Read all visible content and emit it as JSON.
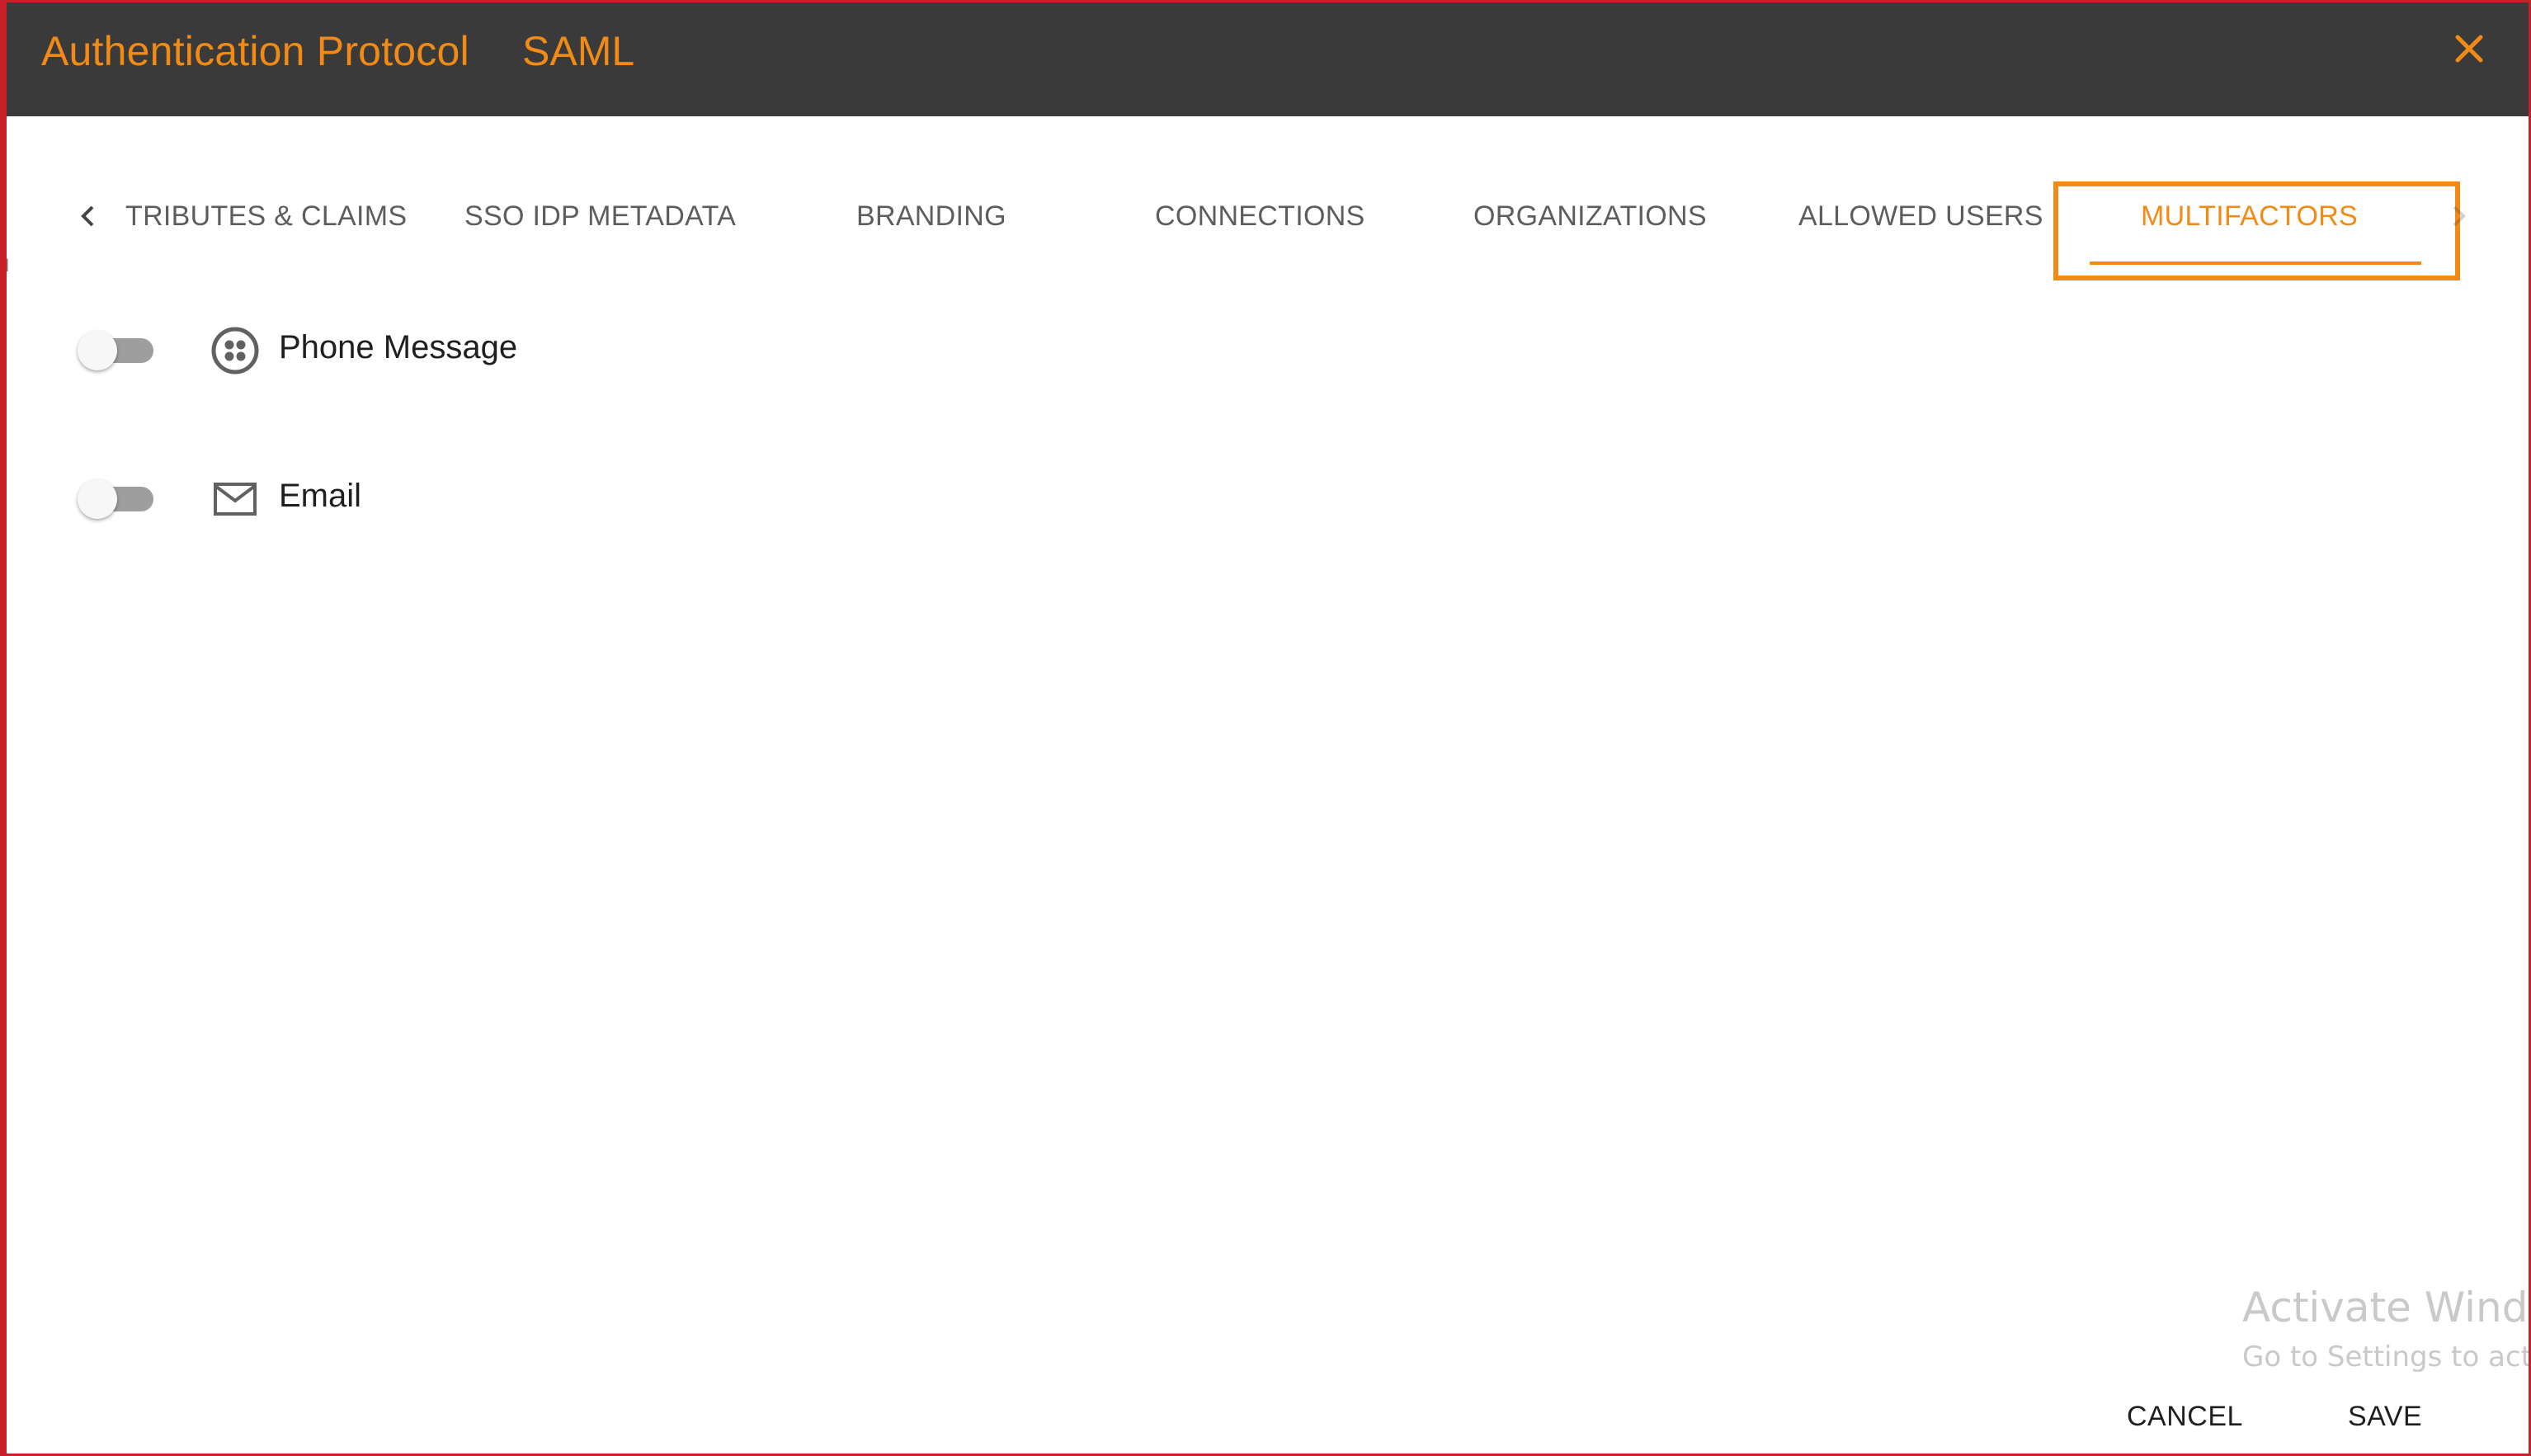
{
  "dialog": {
    "title": "Authentication Protocol",
    "protocol": "SAML"
  },
  "icons": {
    "close": "close-icon",
    "tab_left": "chevron-left-icon",
    "tab_right": "chevron-right-icon",
    "phone": "twilio-icon",
    "email": "mail-icon"
  },
  "colors": {
    "accent": "#f28a16",
    "header_bg": "#3a3a3a",
    "frame_border": "#c8202a"
  },
  "tabs": [
    {
      "label": "TRIBUTES & CLAIMS",
      "active": false
    },
    {
      "label": "SSO IDP METADATA",
      "active": false
    },
    {
      "label": "BRANDING",
      "active": false
    },
    {
      "label": "CONNECTIONS",
      "active": false
    },
    {
      "label": "ORGANIZATIONS",
      "active": false
    },
    {
      "label": "ALLOWED USERS",
      "active": false
    },
    {
      "label": "MULTIFACTORS",
      "active": true
    }
  ],
  "multifactors": [
    {
      "label": "Phone Message",
      "enabled": false
    },
    {
      "label": "Email",
      "enabled": false
    }
  ],
  "footer": {
    "cancel": "CANCEL",
    "save": "SAVE"
  },
  "watermark": {
    "line1": "Activate Windov",
    "line2": "Go to Settings to acti"
  }
}
